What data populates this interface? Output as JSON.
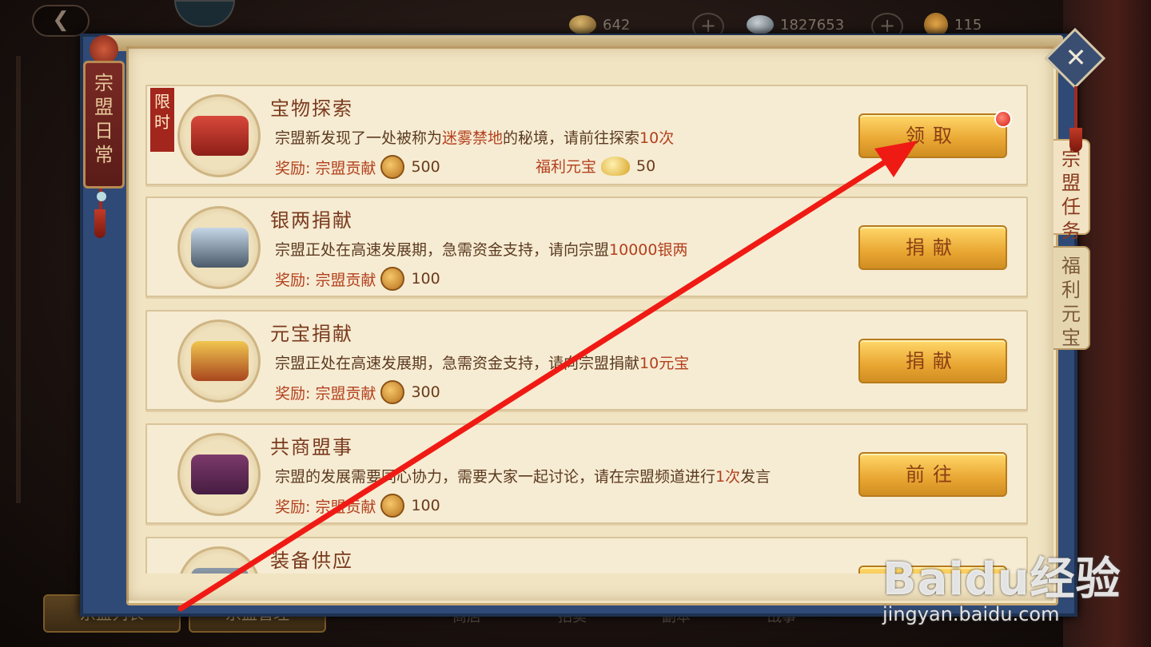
{
  "topbar": {
    "back_label": "",
    "gold": "642",
    "silver": "1827653",
    "coin": "115"
  },
  "side_banner": {
    "label": "宗盟日常"
  },
  "right_tabs": [
    {
      "label": "宗盟任务",
      "active": true
    },
    {
      "label": "福利元宝",
      "active": false
    }
  ],
  "close_label": "✕",
  "tasks": [
    {
      "tag": "限时",
      "title": "宝物探索",
      "desc_pre": "宗盟新发现了一处被称为",
      "desc_hl": "迷雾禁地",
      "desc_post": "的秘境，请前往探索",
      "desc_hl2": "10次",
      "reward_label": "奖励: 宗盟贡献",
      "reward_value": "500",
      "reward2_label": "福利元宝",
      "reward2_value": "50",
      "button": "领取",
      "has_red_dot": true
    },
    {
      "title": "银两捐献",
      "desc_pre": "宗盟正处在高速发展期，急需资金支持，请向宗盟",
      "desc_hl": "10000银两",
      "reward_label": "奖励: 宗盟贡献",
      "reward_value": "100",
      "button": "捐献"
    },
    {
      "title": "元宝捐献",
      "desc_pre": "宗盟正处在高速发展期，急需资金支持，请向宗盟捐献",
      "desc_hl": "10元宝",
      "reward_label": "奖励: 宗盟贡献",
      "reward_value": "300",
      "button": "捐献"
    },
    {
      "title": "共商盟事",
      "desc_pre": "宗盟的发展需要同心协力，需要大家一起讨论，请在宗盟频道进行",
      "desc_hl": "1次",
      "desc_post": "发言",
      "reward_label": "奖励: 宗盟贡献",
      "reward_value": "100",
      "button": "前往"
    },
    {
      "title": "装备供应"
    }
  ],
  "bottom": {
    "btn_list": "宗盟列表",
    "btn_manage": "宗盟管理",
    "tabs": [
      "商店",
      "拍卖",
      "副本",
      "战事"
    ]
  },
  "watermark": {
    "logo": "Baidu经验",
    "url": "jingyan.baidu.com"
  },
  "colors": {
    "accent": "#b3401e",
    "frame": "#2f4a76",
    "parchment": "#f1e4c2",
    "button": "#e9a632",
    "arrow": "#f01a14"
  }
}
